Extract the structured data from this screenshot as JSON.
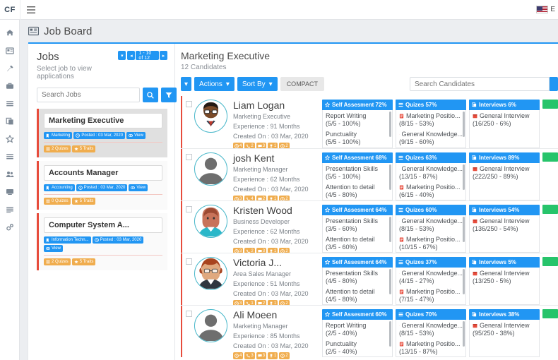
{
  "topbar": {
    "brand": "CF",
    "menu_icon": "hamburger-icon",
    "language": "E",
    "flag": "us-flag-icon"
  },
  "rail": {
    "items": [
      {
        "name": "dashboard-icon"
      },
      {
        "name": "id-card-icon"
      },
      {
        "name": "tools-icon"
      },
      {
        "name": "briefcase-icon"
      },
      {
        "name": "list-icon"
      },
      {
        "name": "copy-icon"
      },
      {
        "name": "star-icon"
      },
      {
        "name": "tasks-icon"
      },
      {
        "name": "users-icon"
      },
      {
        "name": "chalkboard-icon"
      },
      {
        "name": "grid-icon"
      },
      {
        "name": "settings-icon"
      }
    ]
  },
  "page": {
    "title": "Job Board",
    "icon": "job-board-icon"
  },
  "jobs": {
    "title": "Jobs",
    "subtitle": "Select job to view applications",
    "pager": {
      "prev": "◂",
      "label": "1 - 10 of 12",
      "next": "▸",
      "caret": "▾"
    },
    "search_placeholder": "Search Jobs",
    "search_value": "",
    "search_button": "search-icon",
    "filter_button": "filter-icon",
    "cards": [
      {
        "title": "Marketing Executive",
        "active": true,
        "category": "Marketing",
        "posted": "Posted : 03 Mar, 2020",
        "view": "View",
        "quizes": "2 Quizes",
        "traits": "5 Traits"
      },
      {
        "title": "Accounts Manager",
        "active": false,
        "category": "Accounting",
        "posted": "Posted : 03 Mar, 2020",
        "view": "View",
        "quizes": "0 Quizes",
        "traits": "5 Traits"
      },
      {
        "title": "Computer System A...",
        "active": false,
        "category": "Information Techn...",
        "posted": "Posted : 03 Mar, 2020",
        "view": "View",
        "quizes": "2 Quizes",
        "traits": "5 Traits"
      }
    ]
  },
  "candidates": {
    "title": "Marketing Executive",
    "subtitle": "12 Candidates",
    "toolbar": {
      "caret": "▾",
      "actions": "Actions",
      "sort_by": "Sort By",
      "compact": "COMPACT",
      "search_placeholder": "Search Candidates",
      "search_value": "",
      "search_button": "search-icon"
    },
    "rows": [
      {
        "name": "Liam Logan",
        "role": "Marketing Executive",
        "experience": "Experience : 91 Months",
        "created": "Created On : 03 Mar, 2020",
        "mini": [
          {
            "icon": "history-icon",
            "count": "4"
          },
          {
            "icon": "phone-icon",
            "count": "2"
          },
          {
            "icon": "comment-icon",
            "count": "3"
          },
          {
            "icon": "trophy-icon",
            "count": "1"
          },
          {
            "icon": "clock-icon",
            "count": "2"
          }
        ],
        "self_assessment": {
          "header": "Self Assesment 72%",
          "items": [
            {
              "label": "Report Writing",
              "value": "(5/5 - 100%)"
            },
            {
              "label": "Punctuality",
              "value": "(5/5 - 100%)"
            }
          ]
        },
        "quizes": {
          "header": "Quizes 57%",
          "items": [
            {
              "label": "Marketing Positio...",
              "value": "(8/15 - 53%)"
            },
            {
              "label": "General Knowledge...",
              "value": "(9/15 - 60%)"
            }
          ]
        },
        "interviews": {
          "header": "Interviews 6%",
          "items": [
            {
              "label": "General Interview",
              "value": "(16/250 - 6%)"
            }
          ]
        }
      },
      {
        "name": "josh Kent",
        "role": "Marketing Manager",
        "experience": "Experience : 62 Months",
        "created": "Created On : 03 Mar, 2020",
        "mini": [
          {
            "icon": "history-icon",
            "count": "3"
          },
          {
            "icon": "phone-icon",
            "count": "4"
          },
          {
            "icon": "comment-icon",
            "count": "2"
          },
          {
            "icon": "trophy-icon",
            "count": "1"
          },
          {
            "icon": "clock-icon",
            "count": "2"
          }
        ],
        "self_assessment": {
          "header": "Self Assesment 68%",
          "items": [
            {
              "label": "Presentation Skills",
              "value": "(5/5 - 100%)"
            },
            {
              "label": "Attention to detail",
              "value": "(4/5 - 80%)"
            }
          ]
        },
        "quizes": {
          "header": "Quizes 63%",
          "items": [
            {
              "label": "General Knowledge...",
              "value": "(13/15 - 87%)"
            },
            {
              "label": "Marketing Positio...",
              "value": "(6/15 - 40%)"
            }
          ]
        },
        "interviews": {
          "header": "Interviews 89%",
          "items": [
            {
              "label": "General Interview",
              "value": "(222/250 - 89%)"
            }
          ]
        }
      },
      {
        "name": "Kristen Wood",
        "role": "Business Developer",
        "experience": "Experience : 62 Months",
        "created": "Created On : 03 Mar, 2020",
        "mini": [
          {
            "icon": "history-icon",
            "count": "3"
          },
          {
            "icon": "phone-icon",
            "count": "2"
          },
          {
            "icon": "comment-icon",
            "count": "3"
          },
          {
            "icon": "trophy-icon",
            "count": "1"
          },
          {
            "icon": "clock-icon",
            "count": "2"
          }
        ],
        "self_assessment": {
          "header": "Self Assesment 64%",
          "items": [
            {
              "label": "Presentation Skills",
              "value": "(3/5 - 60%)"
            },
            {
              "label": "Attention to detail",
              "value": "(3/5 - 60%)"
            }
          ]
        },
        "quizes": {
          "header": "Quizes 60%",
          "items": [
            {
              "label": "General Knowledge...",
              "value": "(8/15 - 53%)"
            },
            {
              "label": "Marketing Positio...",
              "value": "(10/15 - 67%)"
            }
          ]
        },
        "interviews": {
          "header": "Interviews 54%",
          "items": [
            {
              "label": "General Interview",
              "value": "(136/250 - 54%)"
            }
          ]
        }
      },
      {
        "name": "Victoria J...",
        "role": "Area Sales Manager",
        "experience": "Experience : 51 Months",
        "created": "Created On : 03 Mar, 2020",
        "mini": [
          {
            "icon": "history-icon",
            "count": "3"
          },
          {
            "icon": "phone-icon",
            "count": "1"
          },
          {
            "icon": "comment-icon",
            "count": "2"
          },
          {
            "icon": "trophy-icon",
            "count": "1"
          },
          {
            "icon": "clock-icon",
            "count": "2"
          }
        ],
        "self_assessment": {
          "header": "Self Assesment 64%",
          "items": [
            {
              "label": "Presentation Skills",
              "value": "(4/5 - 80%)"
            },
            {
              "label": "Attention to detail",
              "value": "(4/5 - 80%)"
            }
          ]
        },
        "quizes": {
          "header": "Quizes 37%",
          "items": [
            {
              "label": "General Knowledge...",
              "value": "(4/15 - 27%)"
            },
            {
              "label": "Marketing Positio...",
              "value": "(7/15 - 47%)"
            }
          ]
        },
        "interviews": {
          "header": "Interviews 5%",
          "items": [
            {
              "label": "General Interview",
              "value": "(13/250 - 5%)"
            }
          ]
        }
      },
      {
        "name": "Ali Moeen",
        "role": "Marketing Manager",
        "experience": "Experience : 85 Months",
        "created": "Created On : 03 Mar, 2020",
        "mini": [
          {
            "icon": "history-icon",
            "count": "4"
          },
          {
            "icon": "phone-icon",
            "count": "3"
          },
          {
            "icon": "comment-icon",
            "count": "3"
          },
          {
            "icon": "trophy-icon",
            "count": "1"
          },
          {
            "icon": "clock-icon",
            "count": "2"
          }
        ],
        "self_assessment": {
          "header": "Self Assesment 60%",
          "items": [
            {
              "label": "Report Writing",
              "value": "(2/5 - 40%)"
            },
            {
              "label": "Punctuality",
              "value": "(2/5 - 40%)"
            }
          ]
        },
        "quizes": {
          "header": "Quizes 70%",
          "items": [
            {
              "label": "General Knowledge...",
              "value": "(8/15 - 53%)"
            },
            {
              "label": "Marketing Positio...",
              "value": "(13/15 - 87%)"
            }
          ]
        },
        "interviews": {
          "header": "Interviews 38%",
          "items": [
            {
              "label": "General Interview",
              "value": "(95/250 - 38%)"
            }
          ]
        }
      }
    ]
  },
  "colors": {
    "accent": "#2196f3",
    "orange": "#f0ad4e",
    "red": "#e74c3c",
    "green": "#27c46b"
  }
}
